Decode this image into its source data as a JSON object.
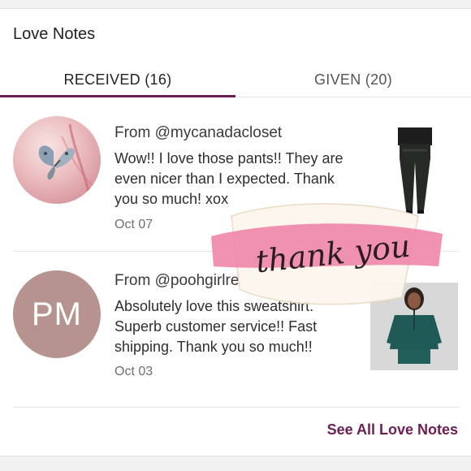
{
  "header": {
    "title": "Love Notes"
  },
  "tabs": [
    {
      "label": "RECEIVED (16)",
      "active": true
    },
    {
      "label": "GIVEN (20)",
      "active": false
    }
  ],
  "notes": [
    {
      "from": "From @mycanadacloset",
      "message": "Wow!! I love those pants!! They are even nicer than I expected. Thank you so much! xox",
      "date": "Oct 07",
      "avatar": "butterfly-photo",
      "product": "black-leather-pants"
    },
    {
      "from": "From @poohgirlre",
      "message": "Absolutely love this sweatshirt. Superb customer service!! Fast shipping. Thank you so much!!",
      "date": "Oct 03",
      "avatar_initials": "PM",
      "product": "green-half-zip-sweatshirt"
    }
  ],
  "sticker": {
    "text": "thank you"
  },
  "footer": {
    "see_all": "See All Love Notes"
  },
  "colors": {
    "accent": "#6a1f55",
    "avatar_pm": "#b6938f",
    "sticker_pink": "#ee7fa6"
  }
}
